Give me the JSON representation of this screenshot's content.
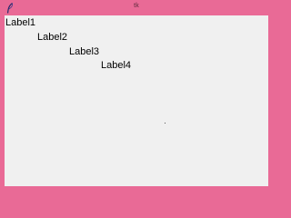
{
  "window": {
    "title": "tk",
    "app_icon": "feather-icon",
    "frame_color": "#e96a96",
    "client_background": "#f0f0f0"
  },
  "labels": [
    {
      "text": "Label1"
    },
    {
      "text": "Label2"
    },
    {
      "text": "Label3"
    },
    {
      "text": "Label4"
    }
  ]
}
